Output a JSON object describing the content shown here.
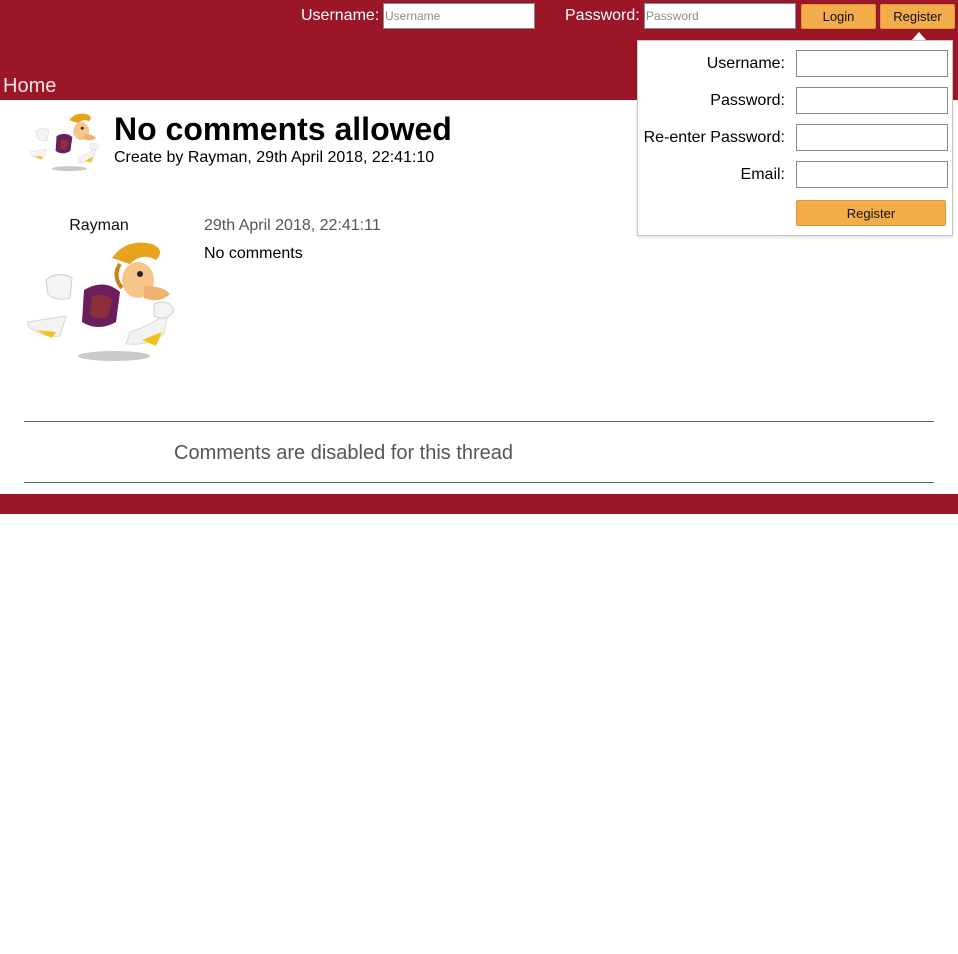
{
  "header": {
    "username_label": "Username:",
    "username_placeholder": "Username",
    "password_label": "Password:",
    "password_placeholder": "Password",
    "login_button": "Login",
    "register_button": "Register",
    "nav_home": "Home"
  },
  "thread": {
    "title": "No comments allowed",
    "meta": "Create by Rayman, 29th April 2018, 22:41:10"
  },
  "post": {
    "username": "Rayman",
    "date": "29th April 2018, 22:41:11",
    "body": "No comments"
  },
  "comments_disabled": "Comments are disabled for this thread",
  "register_panel": {
    "username_label": "Username:",
    "password_label": "Password:",
    "reenter_label": "Re-enter Password:",
    "email_label": "Email:",
    "submit_button": "Register"
  },
  "colors": {
    "brand": "#9b1727",
    "button": "#f2ac4a"
  },
  "icons": {
    "avatar": "rayman-avatar"
  }
}
